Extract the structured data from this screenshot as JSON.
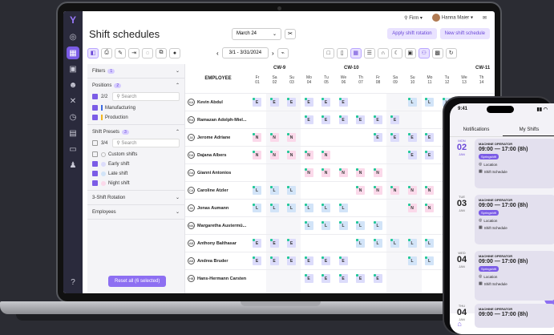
{
  "app": {
    "title": "Shift schedules",
    "month": "March 24",
    "range": "3/1 - 3/31/2024"
  },
  "topbar": {
    "company": "Firm",
    "user": "Hanna Maier"
  },
  "buttons": {
    "rotation": "Apply shift rotation",
    "new": "New shift schedule",
    "reset": "Reset all (6 selected)"
  },
  "filters": {
    "title": "Filters",
    "count": "1",
    "positions": {
      "title": "Positions",
      "count": "2",
      "selected": "2/2",
      "search": "Search",
      "items": [
        "Manufacturing",
        "Production"
      ]
    },
    "presets": {
      "title": "Shift Presets",
      "count": "3",
      "selected": "3/4",
      "search": "Search",
      "items": [
        "Custom shifts",
        "Early shift",
        "Late shift",
        "Night shift"
      ]
    },
    "rotation": "3-Shift Rotation",
    "employees": "Employees"
  },
  "table": {
    "employee_header": "EMPLOYEE",
    "weeks": [
      "CW-9",
      "CW-10",
      "CW-11"
    ],
    "days": [
      {
        "w": "Fr",
        "d": "01"
      },
      {
        "w": "Sa",
        "d": "02"
      },
      {
        "w": "Su",
        "d": "03"
      },
      {
        "w": "Mo",
        "d": "04"
      },
      {
        "w": "Tu",
        "d": "05"
      },
      {
        "w": "We",
        "d": "06"
      },
      {
        "w": "Th",
        "d": "07"
      },
      {
        "w": "Fr",
        "d": "08"
      },
      {
        "w": "Sa",
        "d": "09"
      },
      {
        "w": "Su",
        "d": "10"
      },
      {
        "w": "Mo",
        "d": "11"
      },
      {
        "w": "Tu",
        "d": "12"
      },
      {
        "w": "We",
        "d": "13"
      },
      {
        "w": "Th",
        "d": "14"
      }
    ],
    "rows": [
      {
        "ini": "KA",
        "name": "Kevin Abdul",
        "shifts": [
          "E",
          "E",
          "E",
          "E",
          "E",
          "E",
          "",
          "",
          "",
          "L",
          "L",
          "L",
          ""
        ]
      },
      {
        "ini": "RA",
        "name": "Ramazan Adolph-Miel...",
        "shifts": [
          "",
          "",
          "",
          "E",
          "E",
          "E",
          "E",
          "E",
          "E",
          "",
          "",
          "",
          "",
          ""
        ]
      },
      {
        "ini": "JA",
        "name": "Jerome Adriane",
        "shifts": [
          "N",
          "N",
          "N",
          "",
          "",
          "",
          "",
          "E",
          "E",
          "E",
          "E",
          "E",
          "",
          ""
        ]
      },
      {
        "ini": "DA",
        "name": "Dajana Albers",
        "shifts": [
          "N",
          "N",
          "N",
          "N",
          "N",
          "",
          "",
          "",
          "",
          "E",
          "E",
          "E",
          "",
          ""
        ]
      },
      {
        "ini": "GA",
        "name": "Gianni Antonios",
        "shifts": [
          "",
          "",
          "",
          "N",
          "N",
          "N",
          "N",
          "N",
          "",
          "",
          "",
          "",
          "",
          ""
        ]
      },
      {
        "ini": "CA",
        "name": "Caroline Atzler",
        "shifts": [
          "L",
          "L",
          "L",
          "",
          "",
          "",
          "N",
          "N",
          "N",
          "N",
          "N",
          "",
          "",
          ""
        ]
      },
      {
        "ini": "JA",
        "name": "Jonas Aumann",
        "shifts": [
          "L",
          "L",
          "L",
          "L",
          "L",
          "L",
          "",
          "",
          "",
          "N",
          "N",
          "",
          "",
          ""
        ]
      },
      {
        "ini": "MA",
        "name": "Margaretha Austermü...",
        "shifts": [
          "",
          "",
          "",
          "L",
          "L",
          "L",
          "L",
          "L",
          "",
          "",
          "",
          "",
          "",
          ""
        ]
      },
      {
        "ini": "AB",
        "name": "Anthony Balthasar",
        "shifts": [
          "E",
          "E",
          "E",
          "",
          "",
          "",
          "L",
          "L",
          "L",
          "L",
          "L",
          "",
          "",
          ""
        ]
      },
      {
        "ini": "AB",
        "name": "Andrea Bruder",
        "shifts": [
          "E",
          "E",
          "E",
          "E",
          "E",
          "E",
          "",
          "",
          "",
          "L",
          "L",
          "",
          "",
          ""
        ]
      },
      {
        "ini": "HB",
        "name": "Hans-Hermann Carsten",
        "shifts": [
          "",
          "",
          "",
          "E",
          "E",
          "E",
          "E",
          "E",
          "",
          "",
          "",
          "",
          "",
          ""
        ]
      }
    ]
  },
  "phone": {
    "time": "9:41",
    "tabs": [
      "Notifications",
      "My Shifts"
    ],
    "items": [
      {
        "w": "MON",
        "d": "02",
        "m": "JAN",
        "role": "MACHINE OPERATOR",
        "time": "09:00 — 17:00 (8h)",
        "tag": "Springshift",
        "loc": "Location",
        "sched": "Shift Schedule",
        "today": true
      },
      {
        "w": "TUE",
        "d": "03",
        "m": "JAN",
        "role": "MACHINE OPERATOR",
        "time": "09:00 — 17:00 (8h)",
        "tag": "Springshift",
        "loc": "Location",
        "sched": "Shift Schedule",
        "today": false
      },
      {
        "w": "WED",
        "d": "04",
        "m": "JAN",
        "role": "MACHINE OPERATOR",
        "time": "09:00 — 17:00 (8h)",
        "tag": "Springshift",
        "loc": "Location",
        "sched": "Shift Schedule",
        "today": false
      },
      {
        "w": "THU",
        "d": "04",
        "m": "JAN",
        "role": "MACHINE OPERATOR",
        "time": "09:00 — 17:00 (8h)",
        "tag": "",
        "loc": "",
        "sched": "",
        "today": false
      }
    ]
  },
  "colors": {
    "accent": "#7b5ce6",
    "early": "#dcdcfb",
    "late": "#d2e4f8",
    "night": "#fbd9ea"
  }
}
